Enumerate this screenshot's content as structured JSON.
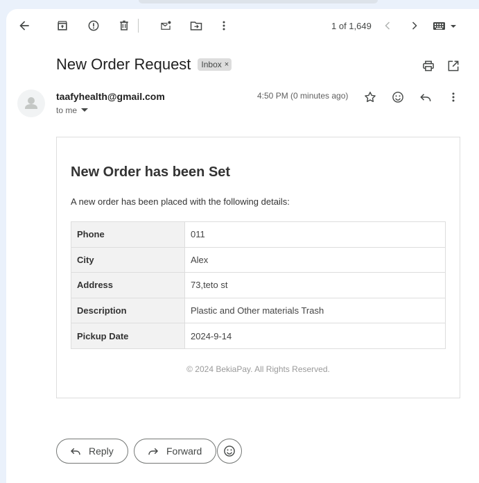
{
  "toolbar": {
    "icons": [
      "back-arrow-icon",
      "archive-icon",
      "report-spam-icon",
      "delete-icon",
      "mark-unread-icon",
      "move-to-icon",
      "more-vert-icon"
    ],
    "pager": "1 of 1,649"
  },
  "message": {
    "subject": "New Order Request",
    "label": "Inbox",
    "label_remove": "×",
    "sender": "taafyhealth@gmail.com",
    "recipient": "to me",
    "time": "4:50 PM (0 minutes ago)"
  },
  "email": {
    "title": "New Order has been Set",
    "intro": "A new order has been placed with the following details:",
    "rows": [
      {
        "key": "Phone",
        "value": "011"
      },
      {
        "key": "City",
        "value": "Alex"
      },
      {
        "key": "Address",
        "value": "73,teto st"
      },
      {
        "key": "Description",
        "value": "Plastic and Other materials Trash"
      },
      {
        "key": "Pickup Date",
        "value": "2024-9-14"
      }
    ],
    "footer": "© 2024 BekiaPay. All Rights Reserved."
  },
  "actions": {
    "reply": "Reply",
    "forward": "Forward"
  },
  "colors": {
    "background": "#eaf1fb",
    "panel": "#ffffff",
    "icon": "#444746",
    "table_key_bg": "#f2f2f2"
  }
}
